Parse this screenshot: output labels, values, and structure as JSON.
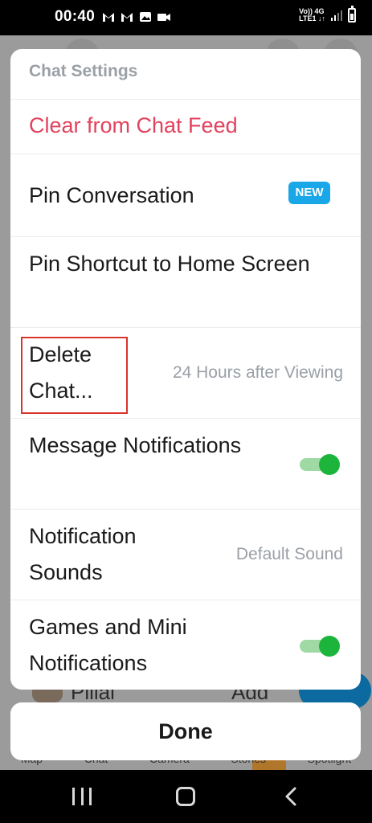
{
  "status_bar": {
    "time": "00:40",
    "net_top": "Vo)) 4G",
    "net_bottom": "LTE1 ↓↑"
  },
  "background": {
    "row_name": "Pillai",
    "add_label": "Add",
    "nav": [
      "Map",
      "Chat",
      "Camera",
      "Stories",
      "Spotlight"
    ]
  },
  "sheet": {
    "title": "Chat Settings",
    "items": [
      {
        "label": "Clear from Chat Feed"
      },
      {
        "label": "Pin Conversation",
        "badge": "NEW"
      },
      {
        "label": "Pin Shortcut to Home Screen"
      },
      {
        "label": "Delete Chat...",
        "value": "24 Hours after Viewing"
      },
      {
        "label": "Message Notifications",
        "toggle": true
      },
      {
        "label": "Notification Sounds",
        "value": "Default Sound"
      },
      {
        "label": "Games and Mini Notifications",
        "toggle": true
      }
    ]
  },
  "done_label": "Done",
  "colors": {
    "destructive": "#e2425d",
    "badge": "#1aa7e8",
    "toggle_on": "#1db43c",
    "highlight": "#d9342b"
  }
}
